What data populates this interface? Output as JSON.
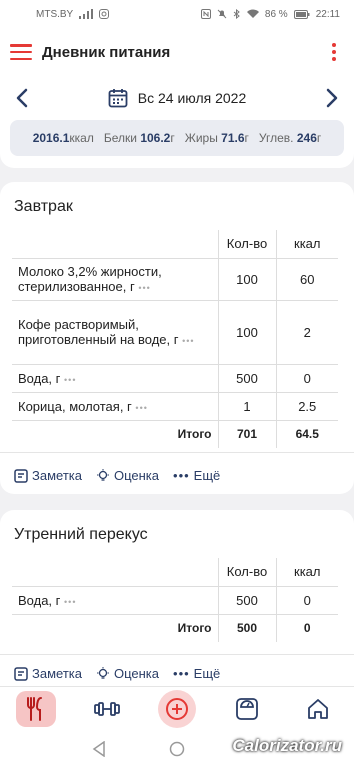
{
  "status": {
    "carrier": "MTS.BY",
    "battery": "86 %",
    "time": "22:11"
  },
  "appbar": {
    "title": "Дневник питания"
  },
  "date": {
    "label": "Вс 24 июля 2022"
  },
  "summary": {
    "kcal_value": "2016.1",
    "kcal_unit": "ккал",
    "protein_label": "Белки",
    "protein_value": "106.2",
    "protein_unit": "г",
    "fat_label": "Жиры",
    "fat_value": "71.6",
    "fat_unit": "г",
    "carb_label": "Углев.",
    "carb_value": "246",
    "carb_unit": "г"
  },
  "columns": {
    "qty": "Кол-во",
    "kcal": "ккал",
    "total": "Итого"
  },
  "actions": {
    "note": "Заметка",
    "rating": "Оценка",
    "more": "Ещё"
  },
  "meals": [
    {
      "title": "Завтрак",
      "items": [
        {
          "name": "Молоко 3,2% жирности, стерилизованное, г",
          "qty": "100",
          "kcal": "60"
        },
        {
          "name": "Кофе растворимый, приготовленный на воде, г",
          "qty": "100",
          "kcal": "2"
        },
        {
          "name": "Вода, г",
          "qty": "500",
          "kcal": "0"
        },
        {
          "name": "Корица, молотая, г",
          "qty": "1",
          "kcal": "2.5"
        }
      ],
      "total_qty": "701",
      "total_kcal": "64.5"
    },
    {
      "title": "Утренний перекус",
      "items": [
        {
          "name": "Вода, г",
          "qty": "500",
          "kcal": "0"
        }
      ],
      "total_qty": "500",
      "total_kcal": "0"
    }
  ],
  "watermark": "Calorizator.ru",
  "colors": {
    "accent": "#e53935",
    "navy": "#2a3d66"
  }
}
